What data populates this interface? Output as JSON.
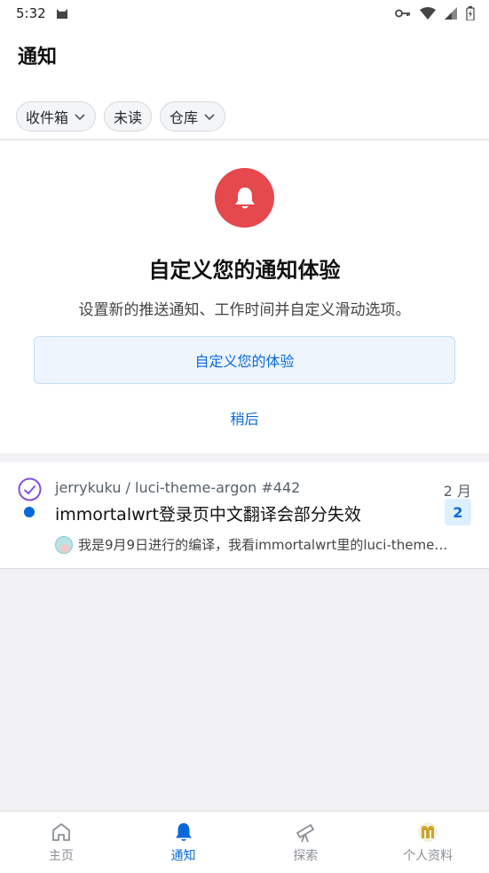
{
  "status": {
    "time": "5:32"
  },
  "header": {
    "title": "通知"
  },
  "filters": [
    {
      "label": "收件箱",
      "dropdown": true
    },
    {
      "label": "未读",
      "dropdown": false
    },
    {
      "label": "仓库",
      "dropdown": true
    }
  ],
  "promo": {
    "title": "自定义您的通知体验",
    "description": "设置新的推送通知、工作时间并自定义滑动选项。",
    "primary_button": "自定义您的体验",
    "secondary_button": "稍后"
  },
  "notifications": [
    {
      "repo": "jerrykuku / luci-theme-argon #442",
      "date": "2 月",
      "title": "immortalwrt登录页中文翻译会部分失效",
      "count": "2",
      "preview": "我是9月9日进行的编译，我看immortalwrt里的luci-theme-argon…"
    }
  ],
  "bottom_nav": [
    {
      "label": "主页",
      "icon": "home-icon",
      "active": false
    },
    {
      "label": "通知",
      "icon": "bell-icon",
      "active": true
    },
    {
      "label": "探索",
      "icon": "telescope-icon",
      "active": false
    },
    {
      "label": "个人资料",
      "icon": "profile-avatar-icon",
      "active": false
    }
  ],
  "colors": {
    "accent": "#0969da",
    "bell": "#e5484d",
    "check": "#8250df"
  }
}
